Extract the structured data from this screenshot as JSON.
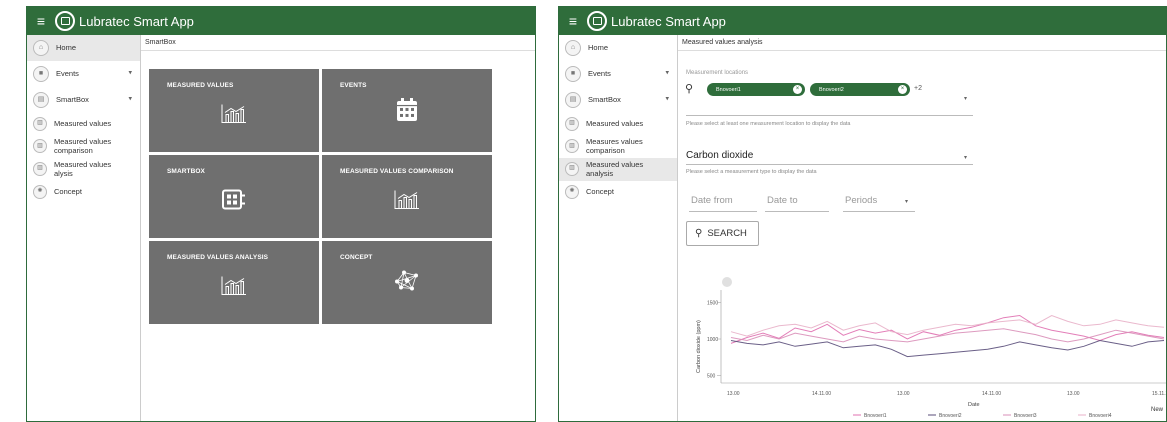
{
  "app_title": "Lubratec Smart App",
  "screen1": {
    "breadcrumb": "SmartBox",
    "nav": [
      {
        "label": "Home",
        "icon": "home-icon",
        "glyph": "⌂",
        "active": true,
        "arrow": false
      },
      {
        "label": "Events",
        "icon": "events-icon",
        "glyph": "■",
        "active": false,
        "arrow": true
      },
      {
        "label": "SmartBox",
        "icon": "smartbox-icon",
        "glyph": "▤",
        "active": false,
        "arrow": true
      },
      {
        "label": "Measured values",
        "icon": "chart-icon",
        "glyph": "▥",
        "active": false,
        "arrow": false,
        "sub": true
      },
      {
        "label": "Measured values comparison",
        "icon": "chart-icon",
        "glyph": "▥",
        "active": false,
        "arrow": false,
        "sub": true
      },
      {
        "label": "Measured values alysis",
        "icon": "chart-icon",
        "glyph": "▥",
        "active": false,
        "arrow": false,
        "sub": true
      },
      {
        "label": "Concept",
        "icon": "concept-icon",
        "glyph": "✺",
        "active": false,
        "arrow": false,
        "sub": true
      }
    ],
    "tiles": [
      {
        "title": "MEASURED VALUES",
        "icon": "bar-chart-icon"
      },
      {
        "title": "EVENTS",
        "icon": "calendar-icon"
      },
      {
        "title": "SMARTBOX",
        "icon": "smartbox-device-icon"
      },
      {
        "title": "MEASURED VALUES COMPARISON",
        "icon": "bar-chart-icon"
      },
      {
        "title": "MEASURED VALUES ANALYSIS",
        "icon": "bar-chart-icon"
      },
      {
        "title": "CONCEPT",
        "icon": "network-icon"
      }
    ]
  },
  "screen2": {
    "breadcrumb": "Measured values analysis",
    "nav": [
      {
        "label": "Home",
        "icon": "home-icon",
        "glyph": "⌂",
        "active": false,
        "arrow": false
      },
      {
        "label": "Events",
        "icon": "events-icon",
        "glyph": "■",
        "active": false,
        "arrow": true
      },
      {
        "label": "SmartBox",
        "icon": "smartbox-icon",
        "glyph": "▤",
        "active": false,
        "arrow": true
      },
      {
        "label": "Measured values",
        "icon": "chart-icon",
        "glyph": "▥",
        "active": false,
        "arrow": false,
        "sub": true
      },
      {
        "label": "Measures values comparison",
        "icon": "chart-icon",
        "glyph": "▥",
        "active": false,
        "arrow": false,
        "sub": true
      },
      {
        "label": "Measured values analysis",
        "icon": "chart-icon",
        "glyph": "▥",
        "active": true,
        "arrow": false,
        "sub": true
      },
      {
        "label": "Concept",
        "icon": "concept-icon",
        "glyph": "✺",
        "active": false,
        "arrow": false,
        "sub": true
      }
    ],
    "locations_label": "Measurement locations",
    "chips": [
      "Bnovoeri1",
      "Bnovoeri2"
    ],
    "more_count": "+2",
    "locations_hint": "Please select at least one measurement location to display the data",
    "measurement_type": "Carbon dioxide",
    "type_hint": "Please select a measurement type to display the data",
    "date_from": "Date from",
    "date_to": "Date to",
    "periods": "Periods",
    "search_label": "SEARCH",
    "new_label": "New"
  },
  "chart_data": {
    "type": "line",
    "xlabel": "Date",
    "ylabel": "Carbon dioxide (ppm)",
    "yticks": [
      "1500",
      "1000",
      "500"
    ],
    "xticks": [
      "13.00",
      "14.11.00",
      "13.00",
      "14.11.00",
      "13.00",
      "15.11.20"
    ],
    "ylim": [
      400,
      1600
    ],
    "series": [
      {
        "name": "Bnovoeri1",
        "color": "#e070b0",
        "values": [
          940,
          1020,
          1080,
          1010,
          1150,
          1100,
          1200,
          1050,
          1130,
          1080,
          1120,
          1000,
          1100,
          1050,
          1120,
          1160,
          1220,
          1290,
          1320,
          1180,
          1120,
          1080,
          1040,
          980,
          1060,
          1100,
          1050,
          1020
        ]
      },
      {
        "name": "Bnovoeri2",
        "color": "#5a4e7a",
        "values": [
          980,
          940,
          920,
          960,
          900,
          930,
          960,
          880,
          900,
          920,
          860,
          760,
          780,
          800,
          820,
          840,
          860,
          900,
          960,
          920,
          880,
          850,
          900,
          980,
          940,
          900,
          960,
          980
        ]
      },
      {
        "name": "Bnovoeri3",
        "color": "#d98fb8",
        "values": [
          1020,
          980,
          1050,
          1000,
          1080,
          1040,
          1000,
          960,
          1040,
          1000,
          980,
          960,
          1000,
          1040,
          1080,
          1100,
          1120,
          1140,
          1100,
          1060,
          1000,
          960,
          1000,
          1060,
          1120,
          1080,
          1040,
          1000
        ]
      },
      {
        "name": "Bnovoeri4",
        "color": "#e8b0c8",
        "values": [
          1100,
          1040,
          1120,
          1180,
          1200,
          1150,
          1240,
          1120,
          1180,
          1220,
          1100,
          1060,
          1120,
          1160,
          1200,
          1180,
          1220,
          1240,
          1260,
          1200,
          1320,
          1240,
          1180,
          1200,
          1260,
          1220,
          1180,
          1160
        ]
      }
    ]
  }
}
